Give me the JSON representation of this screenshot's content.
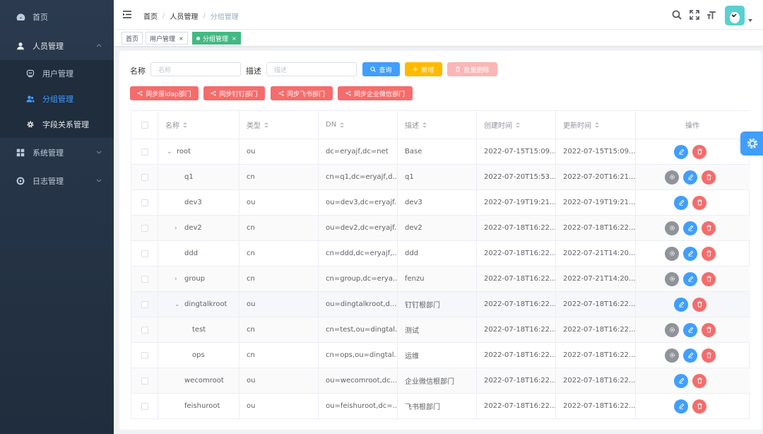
{
  "sidebar": {
    "items": [
      {
        "label": "首页",
        "icon": "dashboard-icon"
      },
      {
        "label": "人员管理",
        "icon": "user-icon"
      },
      {
        "label": "系统管理",
        "icon": "grid-icon"
      },
      {
        "label": "日志管理",
        "icon": "log-icon"
      }
    ],
    "sub_items": [
      {
        "label": "用户管理",
        "icon": "user-manage-icon"
      },
      {
        "label": "分组管理",
        "icon": "group-icon"
      },
      {
        "label": "字段关系管理",
        "icon": "gear-icon"
      }
    ]
  },
  "navbar": {
    "breadcrumb": [
      "首页",
      "人员管理",
      "分组管理"
    ],
    "icons": [
      "search-icon",
      "fullscreen-icon",
      "font-size-icon"
    ]
  },
  "tags": [
    {
      "label": "首页"
    },
    {
      "label": "用户管理",
      "close": "×"
    },
    {
      "label": "分组管理",
      "close": "×"
    }
  ],
  "filter": {
    "name_label": "名称",
    "name_placeholder": "名称",
    "desc_label": "描述",
    "desc_placeholder": "描述",
    "query_label": "查询",
    "add_label": "新增",
    "batch_delete_label": "批量删除"
  },
  "sync_buttons": [
    "同步原ldap部门",
    "同步钉钉部门",
    "同步飞书部门",
    "同步企业微信部门"
  ],
  "table": {
    "columns": [
      "名称",
      "类型",
      "DN",
      "描述",
      "创建时间",
      "更新时间",
      "操作"
    ],
    "rows": [
      {
        "name": "root",
        "type": "ou",
        "dn": "dc=eryajf,dc=net",
        "desc": "Base",
        "created": "2022-07-15T15:09...",
        "updated": "2022-07-15T15:09...",
        "expand": "⌄",
        "level": 0,
        "actions": [
          "edit",
          "delete"
        ]
      },
      {
        "name": "q1",
        "type": "cn",
        "dn": "cn=q1,dc=eryajf,d...",
        "desc": "q1",
        "created": "2022-07-20T15:53...",
        "updated": "2022-07-20T16:21...",
        "expand": "",
        "level": 1,
        "actions": [
          "members",
          "edit",
          "delete"
        ]
      },
      {
        "name": "dev3",
        "type": "ou",
        "dn": "ou=dev3,dc=eryajf...",
        "desc": "dev3",
        "created": "2022-07-19T19:21...",
        "updated": "2022-07-19T19:21...",
        "expand": "",
        "level": 1,
        "actions": [
          "edit",
          "delete"
        ]
      },
      {
        "name": "dev2",
        "type": "cn",
        "dn": "ou=dev2,dc=eryajf...",
        "desc": "dev2",
        "created": "2022-07-18T16:22...",
        "updated": "2022-07-18T16:22...",
        "expand": "›",
        "level": 1,
        "actions": [
          "members",
          "edit",
          "delete"
        ]
      },
      {
        "name": "ddd",
        "type": "cn",
        "dn": "cn=ddd,dc=eryajf,...",
        "desc": "ddd",
        "created": "2022-07-18T16:22...",
        "updated": "2022-07-21T14:20...",
        "expand": "",
        "level": 1,
        "actions": [
          "members",
          "edit",
          "delete"
        ]
      },
      {
        "name": "group",
        "type": "cn",
        "dn": "cn=group,dc=erya...",
        "desc": "fenzu",
        "created": "2022-07-18T16:22...",
        "updated": "2022-07-21T14:20...",
        "expand": "›",
        "level": 1,
        "actions": [
          "members",
          "edit",
          "delete"
        ]
      },
      {
        "name": "dingtalkroot",
        "type": "ou",
        "dn": "ou=dingtalkroot,d...",
        "desc": "钉钉根部门",
        "created": "2022-07-18T16:22...",
        "updated": "2022-07-18T16:22...",
        "expand": "⌄",
        "level": 1,
        "actions": [
          "edit",
          "delete"
        ]
      },
      {
        "name": "test",
        "type": "cn",
        "dn": "cn=test,ou=dingtal...",
        "desc": "测试",
        "created": "2022-07-18T16:22...",
        "updated": "2022-07-18T16:22...",
        "expand": "",
        "level": 2,
        "actions": [
          "members",
          "edit",
          "delete"
        ]
      },
      {
        "name": "ops",
        "type": "cn",
        "dn": "cn=ops,ou=dingtal...",
        "desc": "运维",
        "created": "2022-07-18T16:22...",
        "updated": "2022-07-18T16:22...",
        "expand": "",
        "level": 2,
        "actions": [
          "members",
          "edit",
          "delete"
        ]
      },
      {
        "name": "wecomroot",
        "type": "ou",
        "dn": "ou=wecomroot,dc...",
        "desc": "企业微信根部门",
        "created": "2022-07-18T16:22...",
        "updated": "2022-07-18T16:22...",
        "expand": "",
        "level": 1,
        "actions": [
          "edit",
          "delete"
        ]
      },
      {
        "name": "feishuroot",
        "type": "ou",
        "dn": "ou=feishuroot,dc=...",
        "desc": "飞书根部门",
        "created": "2022-07-18T16:22...",
        "updated": "2022-07-18T16:22...",
        "expand": "",
        "level": 1,
        "actions": [
          "edit",
          "delete"
        ]
      }
    ]
  },
  "colors": {
    "sidebar_bg": "#2b3a4f",
    "active_tag": "#42b983",
    "primary": "#409eff",
    "warning": "#ffba00",
    "danger": "#f56c6c",
    "batch_delete": "#fab6b6",
    "info": "#909399"
  }
}
